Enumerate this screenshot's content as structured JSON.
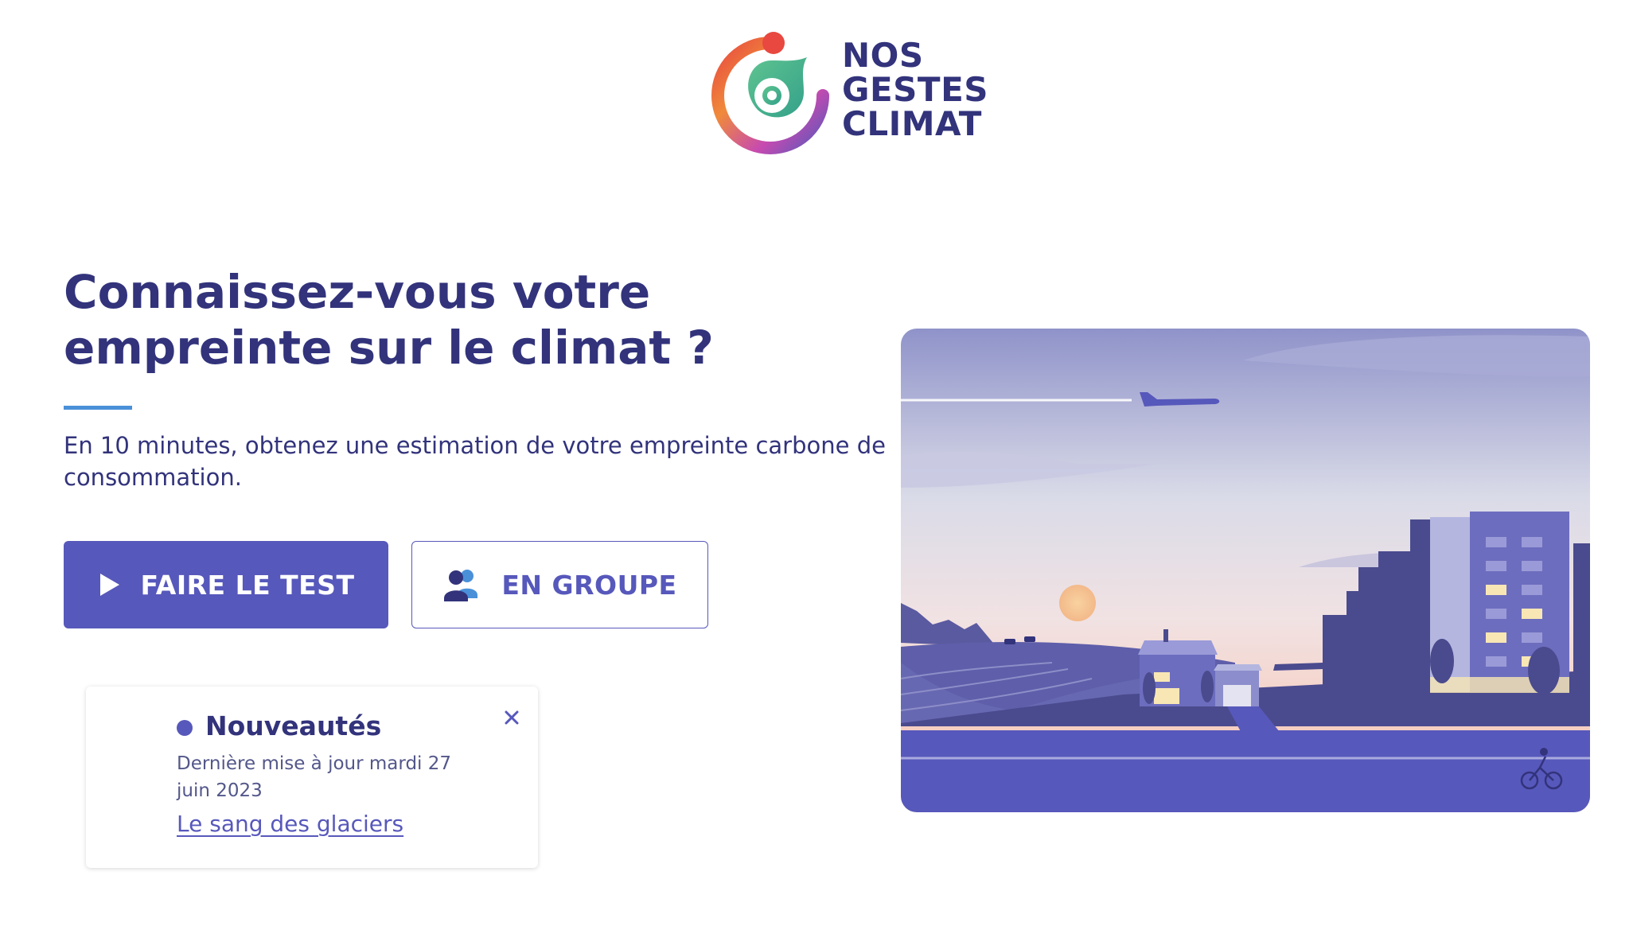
{
  "header": {
    "logo_lines": [
      "NOS",
      "GESTES",
      "CLIMAT"
    ]
  },
  "hero": {
    "title": "Connaissez-vous votre empreinte sur le climat ?",
    "subtitle": "En 10 minutes, obtenez une estimation de votre empreinte carbone de consommation."
  },
  "actions": {
    "primary_label": "FAIRE LE TEST",
    "primary_icon": "play-icon",
    "secondary_label": "EN GROUPE",
    "secondary_icon": "group-users-icon"
  },
  "news": {
    "title": "Nouveautés",
    "date": "Dernière mise à jour mardi 27 juin 2023",
    "link": "Le sang des glaciers",
    "close_icon": "close-icon"
  },
  "colors": {
    "primary": "#5758bb",
    "text": "#32337b",
    "accent_rule": "#4a90d9"
  }
}
